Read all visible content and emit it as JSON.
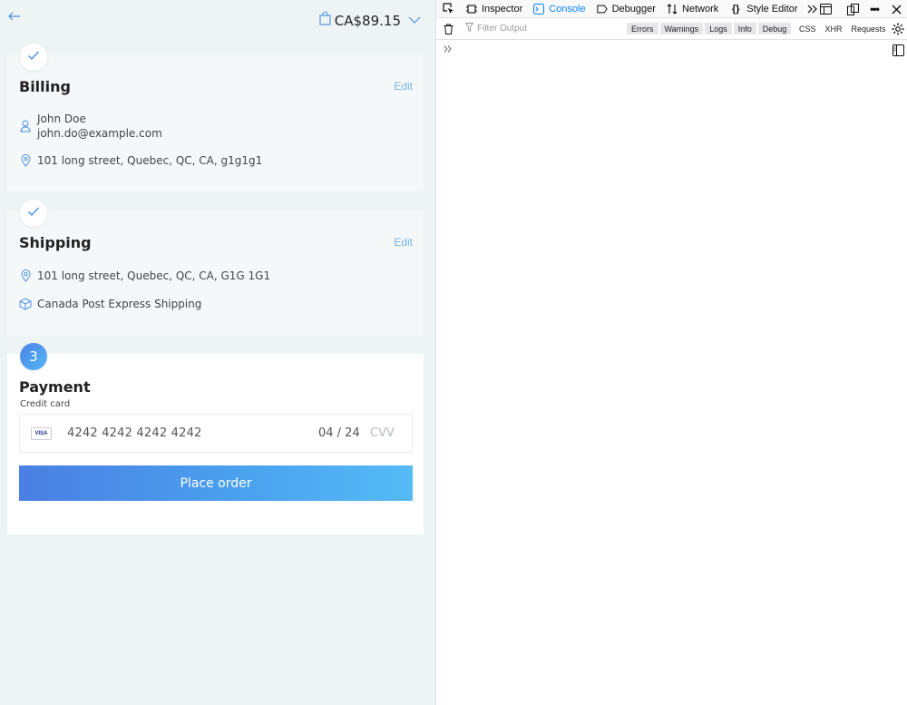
{
  "checkout": {
    "back_icon": "arrow-left-icon",
    "cart": {
      "icon": "shopping-bag-icon",
      "total": "CA$89.15",
      "toggle_icon": "chevron-down-icon"
    },
    "billing": {
      "title": "Billing",
      "edit_label": "Edit",
      "status_icon": "check-icon",
      "name": "John Doe",
      "email": "john.do@example.com",
      "address": "101 long street, Quebec, QC, CA, g1g1g1"
    },
    "shipping": {
      "title": "Shipping",
      "edit_label": "Edit",
      "status_icon": "check-icon",
      "address": "101 long street, Quebec, QC, CA, G1G 1G1",
      "method": "Canada Post Express Shipping"
    },
    "payment": {
      "step": "3",
      "title": "Payment",
      "card_label": "Credit card",
      "card_brand": "VISA",
      "card_number": "4242 4242 4242 4242",
      "expiry": "04 / 24",
      "cvv_placeholder": "CVV",
      "place_order_label": "Place order"
    },
    "colors": {
      "accent": "#4a90e2",
      "edit_link": "#6fb4e6",
      "button_start": "#4a7fe3",
      "button_end": "#55bbf6"
    }
  },
  "devtools": {
    "tabs": [
      {
        "label": "Inspector",
        "icon": "inspector-icon"
      },
      {
        "label": "Console",
        "icon": "console-icon",
        "active": true
      },
      {
        "label": "Debugger",
        "icon": "debugger-icon"
      },
      {
        "label": "Network",
        "icon": "network-icon"
      },
      {
        "label": "Style Editor",
        "icon": "style-editor-icon"
      }
    ],
    "filter_placeholder": "Filter Output",
    "levels": [
      "Errors",
      "Warnings",
      "Logs",
      "Info",
      "Debug"
    ],
    "request_filters": [
      "CSS",
      "XHR",
      "Requests"
    ],
    "active_color": "#0a84ff"
  }
}
